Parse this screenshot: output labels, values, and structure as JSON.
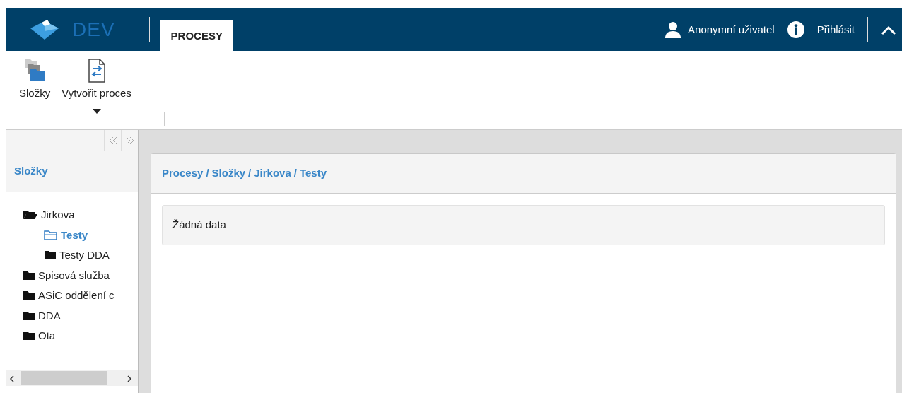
{
  "header": {
    "brand": "DEV",
    "tabs": [
      {
        "label": "PROCESY",
        "selected": true
      }
    ],
    "user": "Anonymní uživatel",
    "login": "Přihlásit"
  },
  "ribbon": {
    "buttons": [
      {
        "label": "Složky",
        "kind": "folders",
        "dropdown": false
      },
      {
        "label": "Vytvořit proces",
        "kind": "process",
        "dropdown": true
      }
    ]
  },
  "sidebar": {
    "title": "Složky",
    "tree": [
      {
        "label": "Jirkova",
        "expanded": true,
        "selected": false,
        "children": [
          {
            "label": "Testy",
            "expanded": false,
            "selected": true
          },
          {
            "label": "Testy DDA",
            "expanded": false,
            "selected": false
          }
        ]
      },
      {
        "label": "Spisová služba",
        "expanded": false,
        "selected": false
      },
      {
        "label": "ASiC oddělení c",
        "expanded": false,
        "selected": false
      },
      {
        "label": "DDA",
        "expanded": false,
        "selected": false
      },
      {
        "label": "Ota",
        "expanded": false,
        "selected": false
      }
    ]
  },
  "content": {
    "breadcrumb": [
      "Procesy",
      "Složky",
      "Jirkova",
      "Testy"
    ],
    "separator": "/",
    "message": "Žádná data"
  }
}
